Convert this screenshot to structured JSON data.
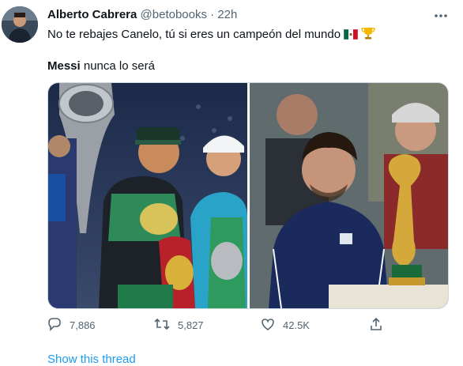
{
  "tweet": {
    "author_name": "Alberto Cabrera",
    "handle": "@betobooks",
    "separator": "·",
    "time": "22h",
    "text_line1": "No te rebajes Canelo, tú si eres un campeón del mundo",
    "text_line2_bold": "Messi",
    "text_line2_rest": " nunca lo será",
    "emoji_flag": "mexico-flag",
    "emoji_trophy": "trophy"
  },
  "actions": {
    "replies": "7,886",
    "retweets": "5,827",
    "likes": "42.5K"
  },
  "show_thread": "Show this thread",
  "images": {
    "left": "canelo-with-belts",
    "right": "messi-with-world-cup"
  },
  "colors": {
    "link": "#1d9bf0",
    "muted": "#536471",
    "text": "#0f1419",
    "argentina_shirt": "#1b2a5c",
    "mexico_green": "#006847",
    "mexico_red": "#ce1126"
  }
}
